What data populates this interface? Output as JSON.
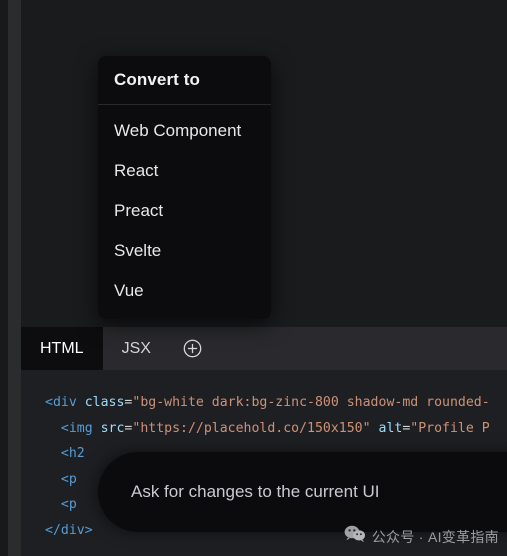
{
  "window": {
    "background_color": "#1a1b1d"
  },
  "dropdown": {
    "title": "Convert to",
    "items": [
      {
        "label": "Web Component"
      },
      {
        "label": "React"
      },
      {
        "label": "Preact"
      },
      {
        "label": "Svelte"
      },
      {
        "label": "Vue"
      }
    ]
  },
  "tabs": {
    "items": [
      {
        "label": "HTML",
        "active": true
      },
      {
        "label": "JSX",
        "active": false
      }
    ],
    "add_icon": "plus-circle-icon"
  },
  "editor": {
    "language": "HTML",
    "lines": [
      {
        "segments": [
          {
            "text": "<div",
            "type": "tag"
          },
          {
            "text": " ",
            "type": "plain"
          },
          {
            "text": "class",
            "type": "attr"
          },
          {
            "text": "=",
            "type": "eq"
          },
          {
            "text": "\"bg-white dark:bg-zinc-800 shadow-md rounded-",
            "type": "str"
          }
        ]
      },
      {
        "segments": [
          {
            "text": "  <img",
            "type": "tag"
          },
          {
            "text": " ",
            "type": "plain"
          },
          {
            "text": "src",
            "type": "attr"
          },
          {
            "text": "=",
            "type": "eq"
          },
          {
            "text": "\"https://placehold.co/150x150\"",
            "type": "str"
          },
          {
            "text": " ",
            "type": "plain"
          },
          {
            "text": "alt",
            "type": "attr"
          },
          {
            "text": "=",
            "type": "eq"
          },
          {
            "text": "\"Profile P",
            "type": "str"
          }
        ]
      },
      {
        "segments": [
          {
            "text": "  <h2",
            "type": "tag"
          }
        ]
      },
      {
        "segments": [
          {
            "text": "  <p",
            "type": "tag"
          }
        ]
      },
      {
        "segments": [
          {
            "text": "  <p",
            "type": "tag"
          }
        ]
      },
      {
        "segments": [
          {
            "text": "</div>",
            "type": "tag"
          }
        ]
      }
    ]
  },
  "ask_pill": {
    "text": "Ask for changes to the current UI"
  },
  "watermark": {
    "icon": "wechat-icon",
    "text": "公众号 · AI变革指南"
  },
  "colors": {
    "panel_bg": "#1e1f22",
    "tabbar_bg": "#2a2a2e",
    "menu_bg": "#0c0c0e",
    "tag": "#569cd6",
    "attr": "#9cdcfe",
    "string": "#ce9178"
  }
}
